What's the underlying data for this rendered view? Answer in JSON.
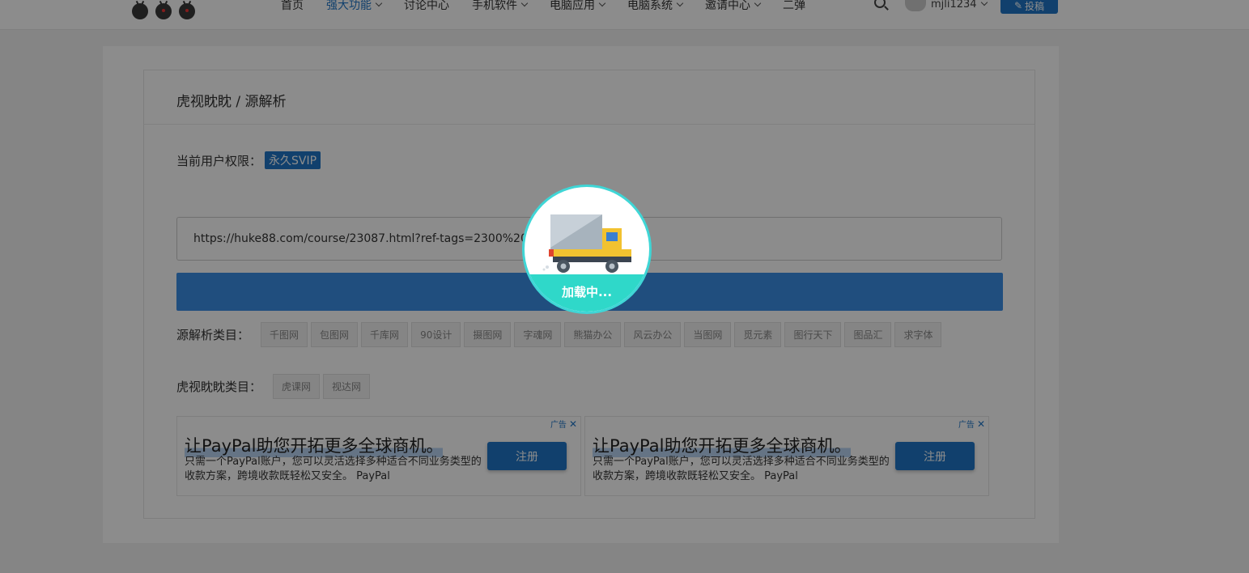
{
  "header": {
    "nav": [
      {
        "label": "首页",
        "active": false,
        "dropdown": false
      },
      {
        "label": "强大功能",
        "active": true,
        "dropdown": true
      },
      {
        "label": "讨论中心",
        "active": false,
        "dropdown": false
      },
      {
        "label": "手机软件",
        "active": false,
        "dropdown": true
      },
      {
        "label": "电脑应用",
        "active": false,
        "dropdown": true
      },
      {
        "label": "电脑系统",
        "active": false,
        "dropdown": true
      },
      {
        "label": "邀请中心",
        "active": false,
        "dropdown": true
      },
      {
        "label": "二弹",
        "active": false,
        "dropdown": false
      }
    ],
    "username": "mjli1234",
    "post_label": "投稿",
    "icons": [
      "logo-icon",
      "search-icon",
      "avatar",
      "edit-icon"
    ]
  },
  "page": {
    "title": "虎视眈眈 / 源解析",
    "permission_label": "当前用户权限：",
    "permission_badge": "永久SVIP",
    "url_value": "https://huke88.com/course/23087.html?ref-tags=2300%20",
    "source_label": "源解析类目：",
    "source_tags": [
      "千图网",
      "包图网",
      "千库网",
      "90设计",
      "摄图网",
      "字魂网",
      "熊猫办公",
      "风云办公",
      "当图网",
      "觅元素",
      "图行天下",
      "图品汇",
      "求字体"
    ],
    "huke_label": "虎视眈眈类目：",
    "huke_tags": [
      "虎课网",
      "视达网"
    ]
  },
  "ads": [
    {
      "tag": "广告",
      "title": "让PayPal助您开拓更多全球商机。",
      "desc": "只需一个PayPal账户，您可以灵活选择多种适合不同业务类型的收款方案，跨境收款既轻松又安全。 PayPal",
      "button": "注册"
    },
    {
      "tag": "广告",
      "title": "让PayPal助您开拓更多全球商机。",
      "desc": "只需一个PayPal账户，您可以灵活选择多种适合不同业务类型的收款方案，跨境收款既轻松又安全。 PayPal",
      "button": "注册"
    }
  ],
  "loader": {
    "text": "加载中..."
  },
  "colors": {
    "accent": "#1f76c6",
    "loader_ring": "#3fd6d6",
    "loader_band": "#2fd8c9"
  }
}
